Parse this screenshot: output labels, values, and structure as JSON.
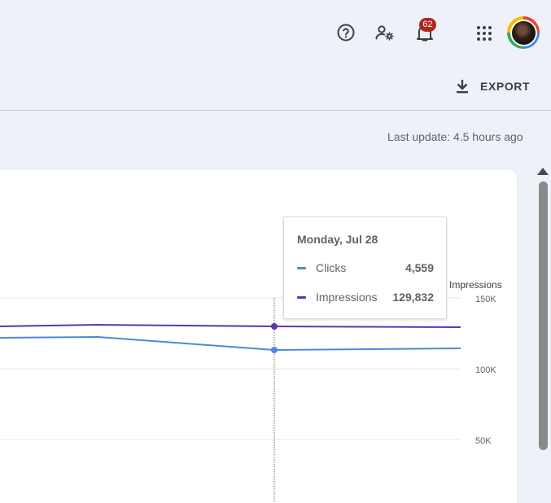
{
  "header": {
    "help_icon": "help-circle-icon",
    "manage_icon": "manage-accounts-icon",
    "notifications_icon": "bell-icon",
    "notifications_count": "62",
    "apps_icon": "apps-grid-icon",
    "avatar_icon": "user-avatar"
  },
  "toolbar": {
    "export_label": "EXPORT",
    "export_icon": "download-icon"
  },
  "status": {
    "last_update": "Last update: 4.5 hours ago"
  },
  "colors": {
    "clicks": "#4285f4",
    "impressions": "#5e35b1",
    "badge": "#b3261e"
  },
  "tooltip": {
    "date": "Monday, Jul 28",
    "rows": [
      {
        "name": "Clicks",
        "value": "4,559"
      },
      {
        "name": "Impressions",
        "value": "129,832"
      }
    ]
  },
  "chart_data": {
    "type": "line",
    "y_right_label": "Impressions",
    "y_right_ticks": [
      "150K",
      "100K",
      "50K"
    ],
    "series": [
      {
        "name": "Clicks",
        "values": [
          null,
          null,
          null,
          4559,
          null
        ]
      },
      {
        "name": "Impressions",
        "values": [
          null,
          null,
          null,
          129832,
          null
        ]
      }
    ],
    "hovered_index": 3
  }
}
